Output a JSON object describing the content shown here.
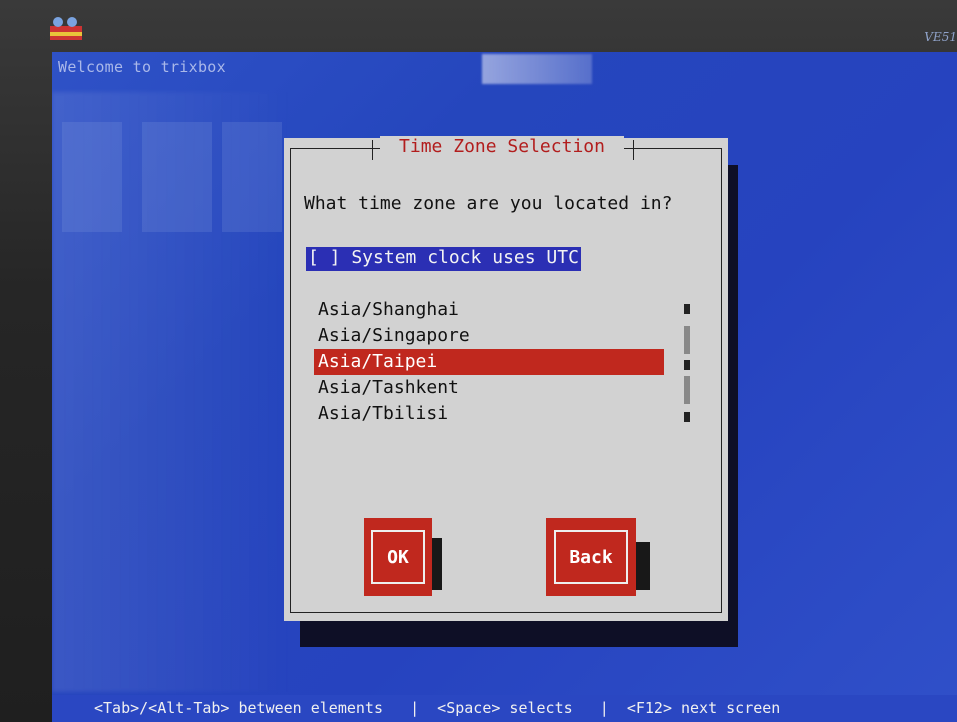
{
  "monitor": {
    "model_label": "VE51"
  },
  "screen": {
    "welcome_text": "Welcome to trixbox"
  },
  "dialog": {
    "title": "Time Zone Selection",
    "question": "What time zone are you located in?",
    "utc_checkbox": {
      "label": "[ ] System clock uses UTC",
      "checked": false
    },
    "timezones": [
      "Asia/Shanghai",
      "Asia/Singapore",
      "Asia/Taipei",
      "Asia/Tashkent",
      "Asia/Tbilisi"
    ],
    "selected_timezone": "Asia/Taipei",
    "ok_label": "OK",
    "back_label": "Back"
  },
  "statusbar": {
    "text": "<Tab>/<Alt-Tab> between elements   |  <Space> selects   |  <F12> next screen"
  },
  "colors": {
    "screen_blue": "#2643bf",
    "dialog_gray": "#d2d2d2",
    "accent_red": "#c0281e",
    "title_red": "#b21d1d",
    "checkbox_highlight": "#2b2fb4"
  }
}
